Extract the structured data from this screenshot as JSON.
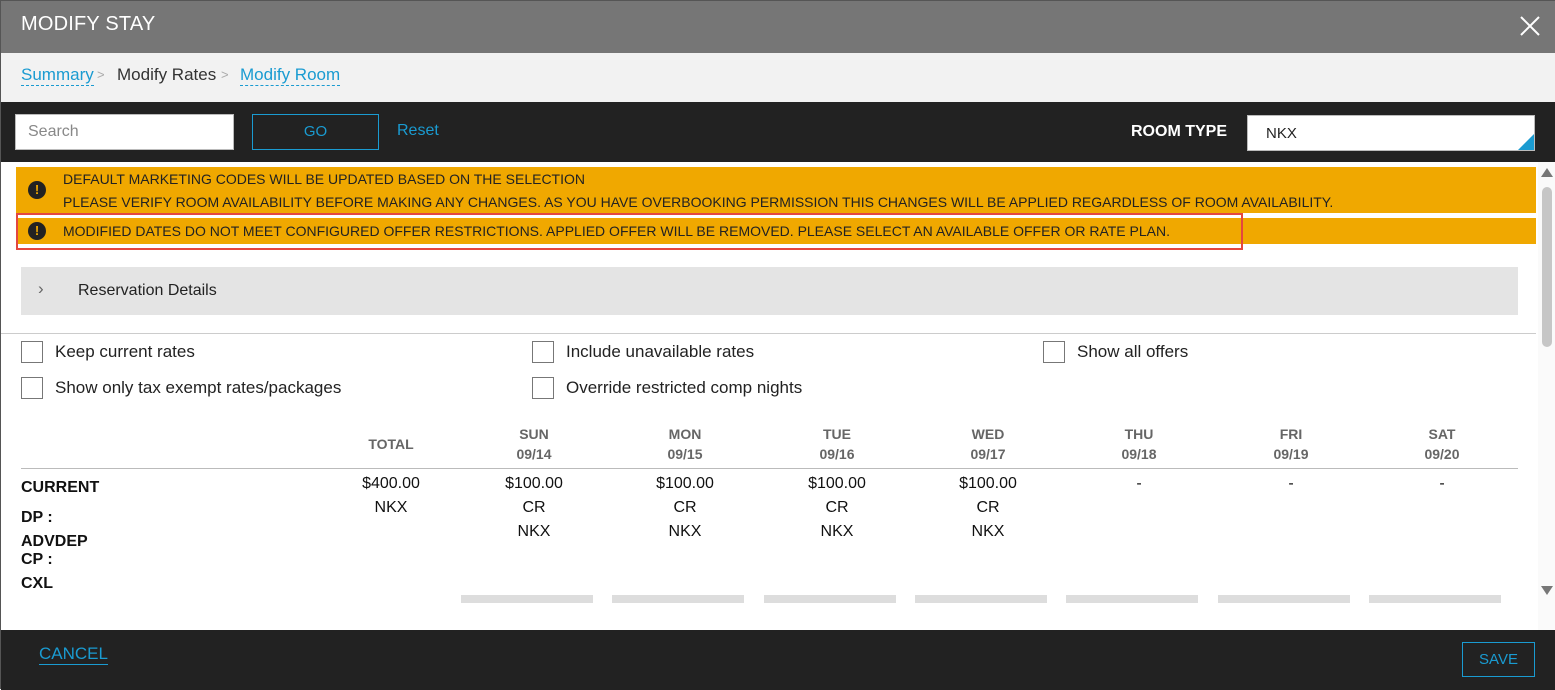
{
  "window": {
    "title": "MODIFY STAY"
  },
  "breadcrumb": {
    "items": [
      "Summary",
      "Modify Rates",
      "Modify Room"
    ],
    "separator": ">"
  },
  "toolbar": {
    "search_placeholder": "Search",
    "go_label": "GO",
    "reset_label": "Reset",
    "room_type_label": "ROOM TYPE",
    "room_type_value": "NKX"
  },
  "banners": {
    "icon": "!",
    "line1": "DEFAULT MARKETING CODES WILL BE UPDATED BASED ON THE SELECTION",
    "line2": "PLEASE VERIFY ROOM AVAILABILITY BEFORE MAKING ANY CHANGES. AS YOU HAVE OVERBOOKING PERMISSION THIS CHANGES WILL BE APPLIED REGARDLESS OF ROOM AVAILABILITY.",
    "line3": "MODIFIED DATES DO NOT MEET CONFIGURED OFFER RESTRICTIONS. APPLIED OFFER WILL BE REMOVED. PLEASE SELECT AN AVAILABLE OFFER OR RATE PLAN."
  },
  "reservation_details": {
    "label": "Reservation Details",
    "chevron": "›"
  },
  "options": {
    "keep_current_rates": "Keep current rates",
    "include_unavailable_rates": "Include unavailable rates",
    "show_all_offers": "Show all offers",
    "show_only_tax_exempt": "Show only tax exempt rates/packages",
    "override_restricted_comp": "Override restricted comp nights"
  },
  "rates_table": {
    "total_header": "TOTAL",
    "days": [
      {
        "day": "SUN",
        "date": "09/14"
      },
      {
        "day": "MON",
        "date": "09/15"
      },
      {
        "day": "TUE",
        "date": "09/16"
      },
      {
        "day": "WED",
        "date": "09/17"
      },
      {
        "day": "THU",
        "date": "09/18"
      },
      {
        "day": "FRI",
        "date": "09/19"
      },
      {
        "day": "SAT",
        "date": "09/20"
      }
    ],
    "current_row": {
      "labels": [
        "CURRENT",
        "DP :",
        "ADVDEP",
        "CP :",
        "CXL"
      ],
      "total": "$400.00",
      "total_room": "NKX",
      "cells": [
        {
          "amount": "$100.00",
          "code": "CR",
          "room": "NKX"
        },
        {
          "amount": "$100.00",
          "code": "CR",
          "room": "NKX"
        },
        {
          "amount": "$100.00",
          "code": "CR",
          "room": "NKX"
        },
        {
          "amount": "$100.00",
          "code": "CR",
          "room": "NKX"
        },
        {
          "amount": "-"
        },
        {
          "amount": "-"
        },
        {
          "amount": "-"
        }
      ]
    }
  },
  "footer": {
    "cancel_label": "CANCEL",
    "save_label": "SAVE"
  },
  "colors": {
    "accent": "#1a9bd1",
    "warning": "#f0a800",
    "highlight": "#e4473f"
  }
}
